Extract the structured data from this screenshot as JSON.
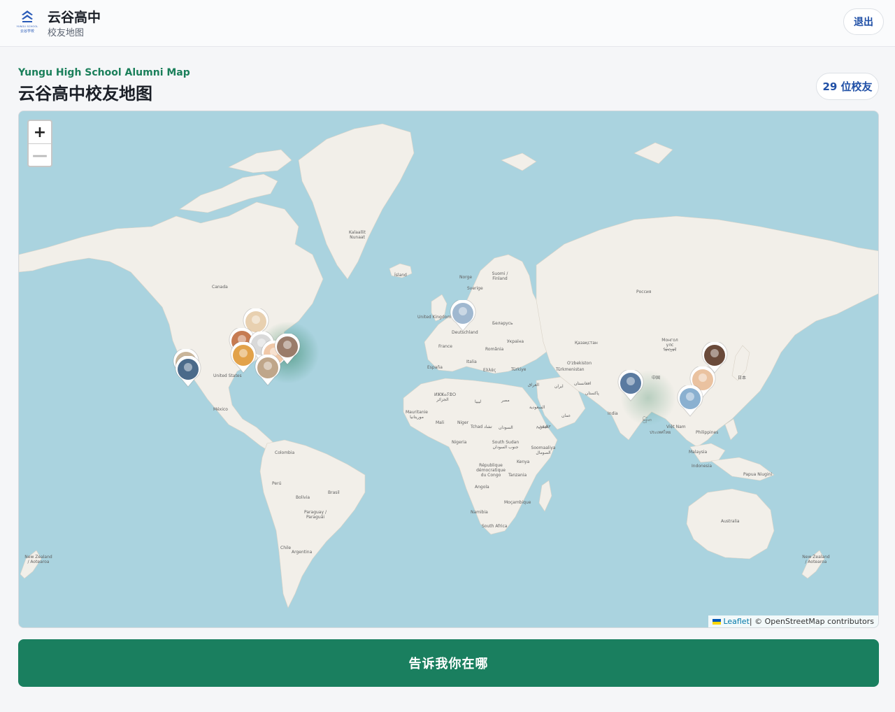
{
  "header": {
    "logo_text_en": "YUNGU SCHOOL",
    "logo_text_zh": "云谷学校",
    "school_name": "云谷高中",
    "school_sub": "校友地图",
    "logout_label": "退出"
  },
  "page": {
    "eyebrow": "Yungu High School Alumni Map",
    "title": "云谷高中校友地图",
    "count_label": "29 位校友"
  },
  "map": {
    "zoom_in": "+",
    "zoom_out": "—",
    "attribution_link": "Leaflet",
    "attribution_text": " | © OpenStreetMap contributors",
    "labels": {
      "canada": "Canada",
      "united_states": "United States",
      "mexico": "México",
      "colombia": "Colombia",
      "peru": "Perú",
      "bolivia": "Bolivia",
      "brasil": "Brasil",
      "paraguay": "Paraguay / Paraguái",
      "chile": "Chile",
      "argentina": "Argentina",
      "greenland": "Kalaallit Nunaat",
      "iceland": "Ísland",
      "norge": "Norge",
      "sverige": "Sverige",
      "suomi": "Suomi / Finland",
      "uk": "United Kingdom",
      "deutschland": "Deutschland",
      "france": "France",
      "espana": "España",
      "italia": "Italia",
      "belarus": "Беларусь",
      "ukraina": "Україна",
      "romania": "România",
      "ellada": "Ελλάς",
      "turkiye": "Türkiye",
      "rossiya": "Россия",
      "kazakhstan": "Қазақстан",
      "uzbekistan": "O'zbekiston",
      "turkmenistan": "Türkmenistan",
      "mongolia": "Монгол улс ᠮᠣᠩᠭᠣᠯ",
      "china": "中国",
      "japan": "日本",
      "india": "India",
      "iran": "ایران",
      "pakistan": "پاکستان",
      "afghanistan": "افغانستان",
      "iraq": "العراق",
      "saudi": "السعودية",
      "oman": "عمان",
      "yemen": "اليمن",
      "libya": "ليبيا",
      "egypt": "مصر",
      "algeria": "ⵍⵣⵣⴰⵢⴻⵔ الجزائر",
      "mauritanie": "Mauritanie موريتانيا",
      "mali": "Mali",
      "niger": "Niger",
      "tchad": "Tchad تشاد",
      "sudan": "السودان",
      "ethiopia": "ኢትዮጵያ",
      "nigeria": "Nigeria",
      "south_sudan": "South Sudan جنوب السودان",
      "somalia": "Soomaaliya الصومال",
      "kenya": "Kenya",
      "rdc": "République démocratique du Congo",
      "tanzania": "Tanzania",
      "angola": "Angola",
      "mocambique": "Moçambique",
      "namibia": "Namibia",
      "south_africa": "South Africa",
      "myanmar": "မြန်မာ",
      "thailand": "ประเทศไทย",
      "vietnam": "Việt Nam",
      "philippines": "Philippines",
      "malaysia": "Malaysia",
      "indonesia": "Indonesia",
      "png": "Papua Niugini",
      "australia": "Australia",
      "nz_left": "New Zealand / Aotearoa",
      "nz_right": "New Zealand / Aotearoa"
    },
    "markers": [
      {
        "name": "alumni-avatar",
        "color": "#c9b59a"
      },
      {
        "name": "alumni-avatar",
        "color": "#4a6a8a"
      },
      {
        "name": "alumni-avatar",
        "color": "#e8d0b0"
      },
      {
        "name": "alumni-avatar",
        "color": "#c67b52"
      },
      {
        "name": "alumni-avatar",
        "color": "#d9d9d9"
      },
      {
        "name": "alumni-avatar",
        "color": "#e2a24a"
      },
      {
        "name": "alumni-avatar",
        "color": "#f0c8a8"
      },
      {
        "name": "alumni-avatar",
        "color": "#9a7c6a"
      },
      {
        "name": "alumni-avatar",
        "color": "#bfa68a"
      },
      {
        "name": "alumni-avatar",
        "color": "#a0b8d0"
      },
      {
        "name": "alumni-avatar",
        "color": "#6a4a3a"
      },
      {
        "name": "alumni-avatar",
        "color": "#eac2a0"
      },
      {
        "name": "alumni-avatar",
        "color": "#5a7aa0"
      },
      {
        "name": "alumni-avatar",
        "color": "#8ab0d0"
      }
    ]
  },
  "cta": {
    "label": "告诉我你在哪"
  },
  "colors": {
    "accent": "#1a7f5f",
    "link": "#1f4fa6",
    "water": "#aad3df",
    "land": "#f2efe9"
  }
}
